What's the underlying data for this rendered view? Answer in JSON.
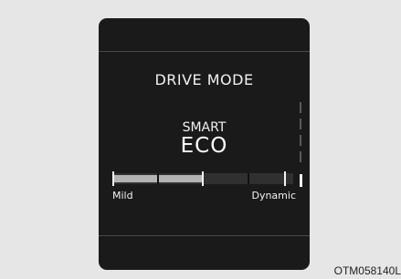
{
  "display": {
    "title": "DRIVE MODE",
    "mode_line1": "SMART",
    "mode_line2": "ECO",
    "gauge": {
      "min_label": "Mild",
      "max_label": "Dynamic",
      "level": 0.5
    }
  },
  "caption": "OTM058140L",
  "colors": {
    "panel_bg": "#1a1a1a",
    "page_bg": "#e6e6e6",
    "text": "#f2f2f2",
    "gauge_fill": "#b3b3b3",
    "gauge_track": "#303030"
  }
}
